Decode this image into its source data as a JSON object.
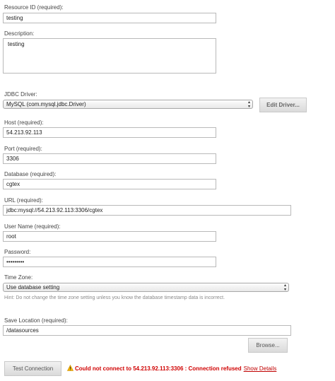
{
  "form": {
    "resource_id": {
      "label": "Resource ID (required):",
      "value": "testing"
    },
    "description": {
      "label": "Description:",
      "value": "testing"
    },
    "jdbc_driver": {
      "label": "JDBC Driver:",
      "value": "MySQL (com.mysql.jdbc.Driver)",
      "edit_button": "Edit Driver..."
    },
    "host": {
      "label": "Host (required):",
      "value": "54.213.92.113"
    },
    "port": {
      "label": "Port (required):",
      "value": "3306"
    },
    "database": {
      "label": "Database (required):",
      "value": "cgtex"
    },
    "url": {
      "label": "URL (required):",
      "value": "jdbc:mysql://54.213.92.113:3306/cgtex"
    },
    "user_name": {
      "label": "User Name (required):",
      "value": "root"
    },
    "password": {
      "label": "Password:",
      "value": "•••••••••"
    },
    "time_zone": {
      "label": "Time Zone:",
      "value": "Use database setting",
      "hint": "Hint: Do not change the time zone setting unless you know the database timestamp data is incorrect."
    },
    "save_location": {
      "label": "Save Location (required):",
      "value": "/datasources",
      "browse_button": "Browse..."
    }
  },
  "footer": {
    "test_button": "Test Connection",
    "status_icon": "warning-triangle-icon",
    "status_message": "Could not connect to 54.213.92.113:3306 : Connection refused",
    "details_link": "Show Details"
  },
  "colors": {
    "error": "#d00000",
    "warning_icon": "#f5b400"
  }
}
